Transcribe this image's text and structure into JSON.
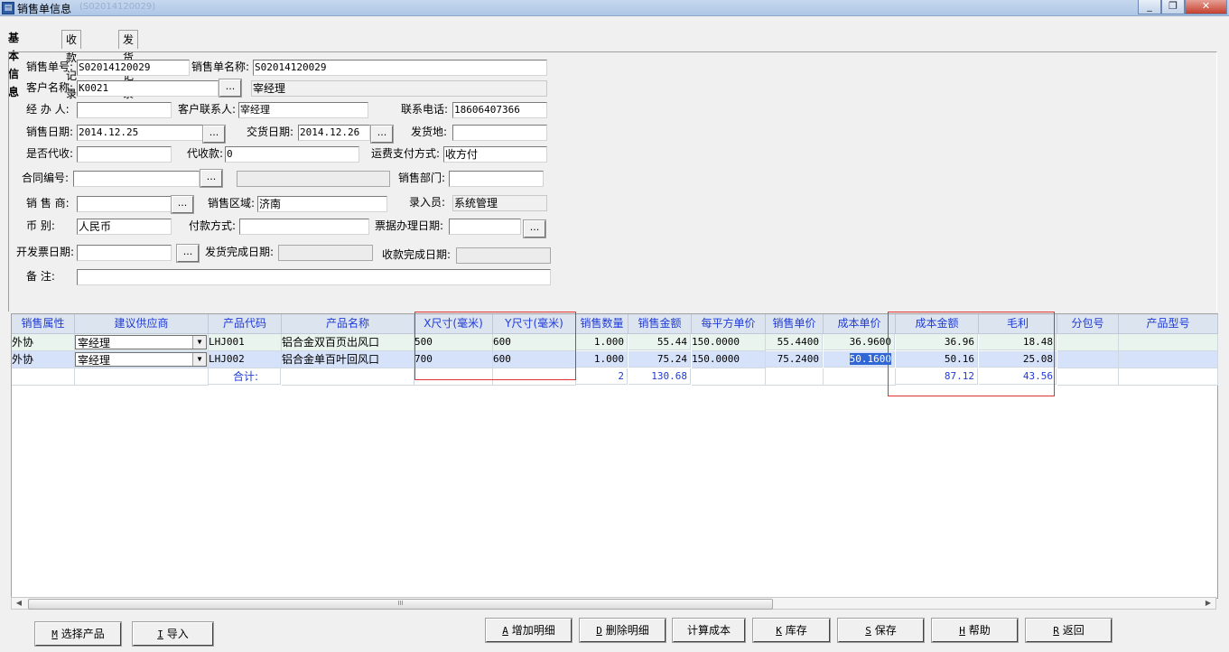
{
  "window": {
    "title": "销售单信息",
    "title_faded": "(S02014120029)",
    "min": "_",
    "max": "❐",
    "close": "✕"
  },
  "tabs": [
    {
      "label": "基本信息"
    },
    {
      "label": "收款记录"
    },
    {
      "label": "发货记录"
    }
  ],
  "form": {
    "order_no_label": "销售单号:",
    "order_no": "S02014120029",
    "order_name_label": "销售单名称:",
    "order_name": "S02014120029",
    "customer_label": "客户名称:",
    "customer": "K0021",
    "customer_name": "宰经理",
    "handler_label": "经 办 人:",
    "handler": "",
    "contact_label": "客户联系人:",
    "contact": "宰经理",
    "phone_label": "联系电话:",
    "phone": "18606407366",
    "sale_date_label": "销售日期:",
    "sale_date": "2014.12.25",
    "delivery_date_label": "交货日期:",
    "delivery_date": "2014.12.26",
    "ship_from_label": "发货地:",
    "ship_from": "",
    "proxy_label": "是否代收:",
    "proxy": "",
    "proxy_amount_label": "代收款:",
    "proxy_amount": "0",
    "freight_label": "运费支付方式:",
    "freight": "收方付",
    "contract_label": "合同编号:",
    "contract": "",
    "contract_extra": "",
    "dept_label": "销售部门:",
    "dept": "",
    "seller_label": "销 售 商:",
    "seller": "",
    "region_label": "销售区域:",
    "region": "济南",
    "entry_label": "录入员:",
    "entry": "系统管理",
    "currency_label": "币    别:",
    "currency": "人民币",
    "pay_label": "付款方式:",
    "pay": "",
    "bill_date_label": "票据办理日期:",
    "bill_date": "",
    "invoice_date_label": "开发票日期:",
    "invoice_date": "",
    "ship_done_label": "发货完成日期:",
    "ship_done": "",
    "receive_done_label": "收款完成日期:",
    "receive_done": "",
    "note_label": "备    注:",
    "note": "",
    "dots": "..."
  },
  "grid": {
    "columns": [
      "销售属性",
      "建议供应商",
      "产品代码",
      "产品名称",
      "X尺寸(毫米)",
      "Y尺寸(毫米)",
      "销售数量",
      "销售金额",
      "每平方单价",
      "销售单价",
      "成本单价",
      "成本金额",
      "毛利",
      "分包号",
      "产品型号"
    ],
    "rows": [
      {
        "attr": "外协",
        "supplier": "宰经理",
        "code": "LHJ001",
        "name": "铝合金双百页出风口",
        "x": "500",
        "y": "600",
        "qty": "1.000",
        "amount": "55.44",
        "sqm": "150.0000",
        "price": "55.4400",
        "cost_price": "36.9600",
        "cost_amount": "36.96",
        "profit": "18.48",
        "pkg": "",
        "model": ""
      },
      {
        "attr": "外协",
        "supplier": "宰经理",
        "code": "LHJ002",
        "name": "铝合金单百叶回风口",
        "x": "700",
        "y": "600",
        "qty": "1.000",
        "amount": "75.24",
        "sqm": "150.0000",
        "price": "75.2400",
        "cost_price": "50.1600",
        "cost_amount": "50.16",
        "profit": "25.08",
        "pkg": "",
        "model": ""
      }
    ],
    "total": {
      "label": "合计:",
      "qty": "2",
      "amount": "130.68",
      "cost_amount": "87.12",
      "profit": "43.56"
    }
  },
  "scroll_grip": "III",
  "buttons": {
    "select_key": "M",
    "select": "选择产品",
    "import_key": "I",
    "import": "导入",
    "add_key": "A",
    "add": "增加明细",
    "del_key": "D",
    "del": "删除明细",
    "calc": "计算成本",
    "stock_key": "K",
    "stock": "库存",
    "save_key": "S",
    "save": "保存",
    "help_key": "H",
    "help": "帮助",
    "back_key": "R",
    "back": "返回"
  }
}
